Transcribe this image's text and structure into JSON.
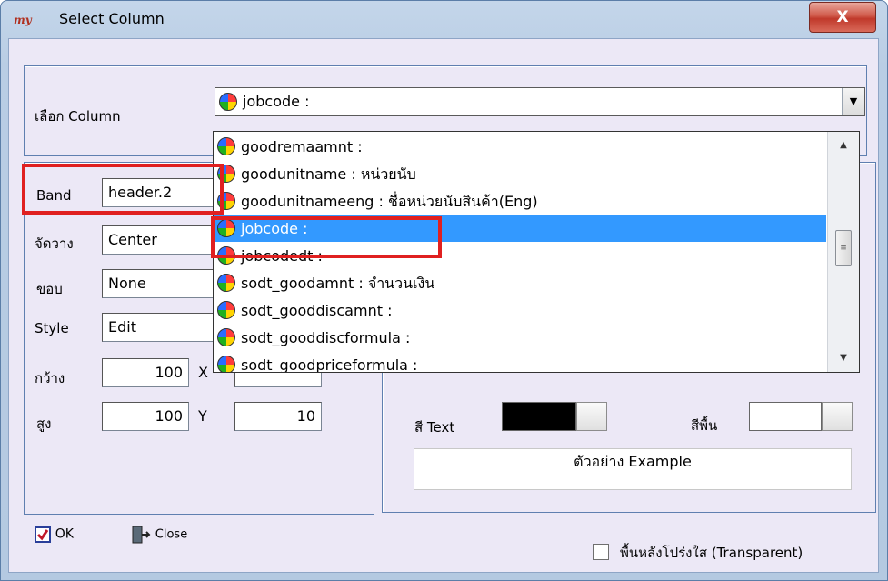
{
  "window": {
    "title": "Select Column",
    "app_icon_text": "my",
    "close_label": "X"
  },
  "column_select": {
    "label": "เลือก Column",
    "value": "jobcode :",
    "dropdown_arrow": "▼",
    "list_items": [
      {
        "text": "goodremaamnt :",
        "selected": false
      },
      {
        "text": "goodunitname : หน่วยนับ",
        "selected": false
      },
      {
        "text": "goodunitnameeng : ชื่อหน่วยนับสินค้า(Eng)",
        "selected": false
      },
      {
        "text": "jobcode :",
        "selected": true
      },
      {
        "text": "jobcodedt :",
        "selected": false
      },
      {
        "text": "sodt_goodamnt : จำนวนเงิน",
        "selected": false
      },
      {
        "text": "sodt_gooddiscamnt :",
        "selected": false
      },
      {
        "text": "sodt_gooddiscformula :",
        "selected": false
      },
      {
        "text": "sodt_goodpriceformula :",
        "selected": false
      }
    ],
    "scroll_up": "▲",
    "scroll_down": "▼",
    "thumb_grip": "≡"
  },
  "props": {
    "band_label": "Band",
    "band_value": "header.2",
    "align_label": "จัดวาง",
    "align_value": "Center",
    "border_label": "ขอบ",
    "border_value": "None",
    "style_label": "Style",
    "style_value": "Edit",
    "width_label": "กว้าง",
    "width_value": "100",
    "x_label": "X",
    "height_label": "สูง",
    "height_value": "100",
    "y_label": "Y",
    "y_value": "10"
  },
  "colors": {
    "text_color_label": "สี Text",
    "text_color": "#000000",
    "bg_color_label": "สีพื้น",
    "bg_color": "#ffffff",
    "example_text": "ตัวอย่าง Example"
  },
  "footer": {
    "ok_label": "OK",
    "close_label": "Close",
    "transparent_label": "พื้นหลังโปร่งใส (Transparent)",
    "transparent_checked": false
  },
  "highlight_color": "#e02020",
  "selection_color": "#3399ff"
}
